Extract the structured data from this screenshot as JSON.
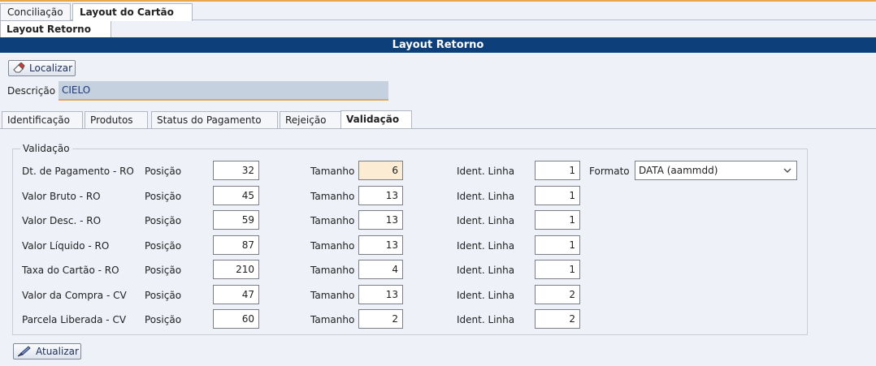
{
  "main_tabs": [
    {
      "label": "Conciliação"
    },
    {
      "label": "Layout do Cartão"
    }
  ],
  "sub_tab": {
    "label": "Layout Retorno"
  },
  "banner": {
    "title": "Layout Retorno"
  },
  "toolbar": {
    "localizar_label": "Localizar",
    "atualizar_label": "Atualizar"
  },
  "descricao": {
    "label": "Descrição",
    "value": "CIELO"
  },
  "inner_tabs": [
    {
      "label": "Identificação"
    },
    {
      "label": "Produtos"
    },
    {
      "label": "Status do Pagamento"
    },
    {
      "label": "Rejeição"
    },
    {
      "label": "Validação"
    }
  ],
  "validacao": {
    "title": "Validação",
    "col_posicao": "Posição",
    "col_tamanho": "Tamanho",
    "col_ident": "Ident. Linha",
    "formato_label": "Formato",
    "formato_value": "DATA (aammdd)",
    "rows": [
      {
        "label": "Dt. de Pagamento - RO",
        "posicao": "32",
        "tamanho": "6",
        "ident": "1"
      },
      {
        "label": "Valor Bruto - RO",
        "posicao": "45",
        "tamanho": "13",
        "ident": "1"
      },
      {
        "label": "Valor Desc. - RO",
        "posicao": "59",
        "tamanho": "13",
        "ident": "1"
      },
      {
        "label": "Valor Líquido - RO",
        "posicao": "87",
        "tamanho": "13",
        "ident": "1"
      },
      {
        "label": "Taxa do Cartão - RO",
        "posicao": "210",
        "tamanho": "4",
        "ident": "1"
      },
      {
        "label": "Valor da Compra - CV",
        "posicao": "47",
        "tamanho": "13",
        "ident": "2"
      },
      {
        "label": "Parcela Liberada - CV",
        "posicao": "60",
        "tamanho": "2",
        "ident": "2"
      }
    ]
  },
  "colors": {
    "banner": "#0d3f7a",
    "accent": "#e9a64a",
    "highlight_field": "#fdecd4"
  }
}
